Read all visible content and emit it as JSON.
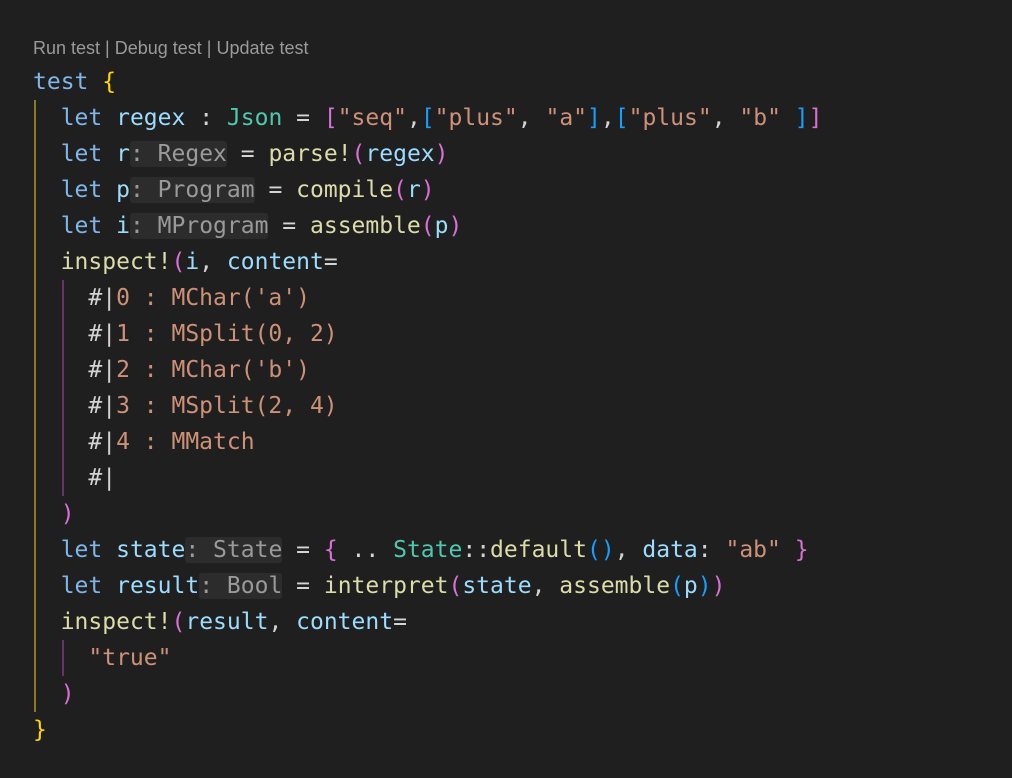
{
  "codelens": {
    "run": "Run test",
    "debug": "Debug test",
    "update": "Update test",
    "sep": " | "
  },
  "code": {
    "test_kw": "test",
    "open_brace": "{",
    "close_brace": "}",
    "let": "let",
    "regex_name": "regex",
    "json_type": "Json",
    "seq": "\"seq\"",
    "plus": "\"plus\"",
    "a": "\"a\"",
    "b": "\"b\"",
    "r": "r",
    "hint_regex": ": Regex",
    "parse_fn": "parse!",
    "p": "p",
    "hint_program": ": Program",
    "compile_fn": "compile",
    "i": "i",
    "hint_mprogram": ": MProgram",
    "assemble_fn": "assemble",
    "inspect_fn": "inspect!",
    "content": "content",
    "ml_lines": [
      "0 : MChar('a')",
      "1 : MSplit(0, 2)",
      "2 : MChar('b')",
      "3 : MSplit(2, 4)",
      "4 : MMatch",
      ""
    ],
    "ml_prefix": "#|",
    "state": "state",
    "hint_state": ": State",
    "state_type": "State",
    "default_fn": "default",
    "data": "data",
    "ab": "\"ab\"",
    "result": "result",
    "hint_bool": ": Bool",
    "interpret_fn": "interpret",
    "true_str": "\"true\""
  }
}
